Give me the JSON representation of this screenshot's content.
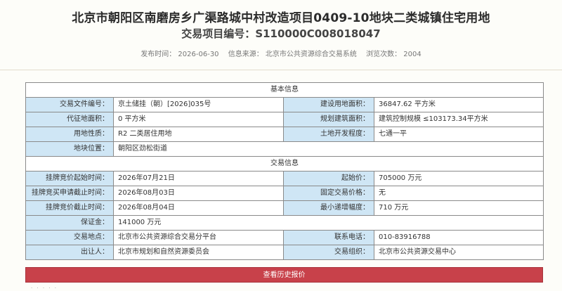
{
  "header": {
    "title": "北京市朝阳区南磨房乡广渠路城中村改造项目0409-10地块二类城镇住宅用地",
    "project_no_label": "交易项目编号：",
    "project_no": "S110000C008018047"
  },
  "meta": {
    "publish_time": "发布时间：  2026-06-30",
    "source": "信息来源：  北京市公共资源综合交易系统",
    "views": "浏览次数：  2004"
  },
  "basic": {
    "section_title": "基本信息",
    "doc_no_label": "交易文件编号：",
    "doc_no": "京土储挂（朝）[2026]035号",
    "land_area_label": "建设用地面积：",
    "land_area": "36847.62 平方米",
    "levy_area_label": "代征地面积：",
    "levy_area": "0 平方米",
    "build_area_label": "规划建筑面积：",
    "build_area": "建筑控制规模 ≤103173.34平方米",
    "usage_label": "用地性质：",
    "usage": "R2 二类居住用地",
    "dev_level_label": "土地开发程度：",
    "dev_level": "七通一平",
    "location_label": "地块位置：",
    "location": "朝阳区劲松街道"
  },
  "trade": {
    "section_title": "交易信息",
    "list_start_label": "挂牌竞价起始时间：",
    "list_start": "2026年07月21日",
    "start_price_label": "起始价：",
    "start_price": "705000 万元",
    "apply_end_label": "挂牌竞买申请截止时间：",
    "apply_end": "2026年08月03日",
    "fixed_price_label": "固定交易价格：",
    "fixed_price": "无",
    "list_end_label": "挂牌竞价截止时间：",
    "list_end": "2026年08月04日",
    "min_increment_label": "最小递增幅度：",
    "min_increment": "710 万元",
    "deposit_label": "保证金：",
    "deposit": "141000 万元",
    "venue_label": "交易地点：",
    "venue": "北京市公共资源综合交易分平台",
    "phone_label": "联系电话：",
    "phone": "010-83916788",
    "seller_label": "出让人：",
    "seller": "北京市规划和自然资源委员会",
    "organizer_label": "交易组织：",
    "organizer": "北京市公共资源交易中心"
  },
  "actions": {
    "history_label": "查看历史报价"
  }
}
